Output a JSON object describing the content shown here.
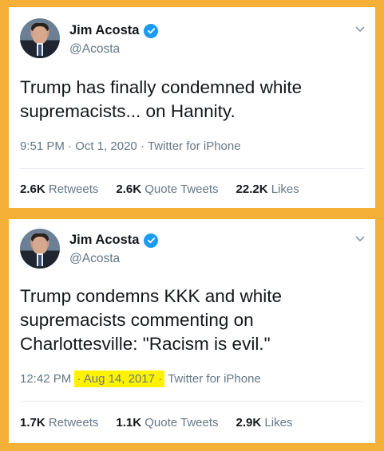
{
  "tweets": [
    {
      "author_name": "Jim Acosta",
      "handle": "@Acosta",
      "text_lines": [
        "Trump has finally condemned white",
        "supremacists... on Hannity."
      ],
      "time": "9:51 PM",
      "date": "Oct 1, 2020",
      "source": "Twitter for iPhone",
      "date_highlighted": false,
      "stats": {
        "retweets_count": "2.6K",
        "retweets_label": "Retweets",
        "quotes_count": "2.6K",
        "quotes_label": "Quote Tweets",
        "likes_count": "22.2K",
        "likes_label": "Likes"
      }
    },
    {
      "author_name": "Jim Acosta",
      "handle": "@Acosta",
      "text_lines": [
        "Trump condemns KKK and white",
        "supremacists commenting on",
        "Charlottesville: \"Racism is evil.\""
      ],
      "time": "12:42 PM",
      "date": "Aug 14, 2017",
      "source": "Twitter for iPhone",
      "date_highlighted": true,
      "stats": {
        "retweets_count": "1.7K",
        "retweets_label": "Retweets",
        "quotes_count": "1.1K",
        "quotes_label": "Quote Tweets",
        "likes_count": "2.9K",
        "likes_label": "Likes"
      }
    }
  ],
  "separator": "·",
  "colors": {
    "frame": "#f5b137",
    "verified": "#1d9bf0",
    "highlight": "#fff200",
    "secondary_text": "#657786",
    "primary_text": "#14171a"
  },
  "icons": [
    "verified-badge-icon",
    "chevron-down-icon"
  ]
}
